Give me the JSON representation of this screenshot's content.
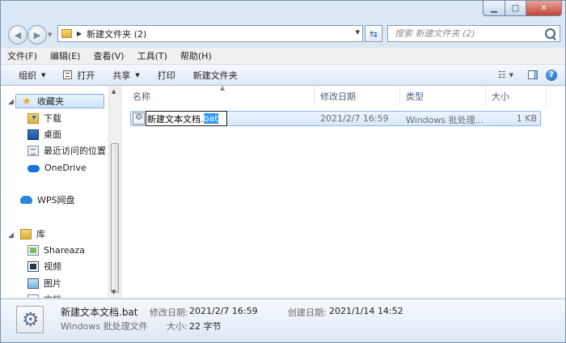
{
  "address": {
    "crumb": "新建文件夹 (2)",
    "search_placeholder": "搜索 新建文件夹 (2)"
  },
  "menubar": [
    "文件(F)",
    "编辑(E)",
    "查看(V)",
    "工具(T)",
    "帮助(H)"
  ],
  "toolbar": {
    "organize": "组织",
    "open": "打开",
    "share": "共享",
    "print": "打印",
    "new_folder": "新建文件夹"
  },
  "nav": {
    "favorites": "收藏夹",
    "downloads": "下载",
    "desktop": "桌面",
    "recent": "最近访问的位置",
    "onedrive": "OneDrive",
    "wps": "WPS网盘",
    "libraries": "库",
    "shareaza": "Shareaza",
    "videos": "视频",
    "pictures": "图片",
    "documents": "文档"
  },
  "columns": {
    "name": "名称",
    "modified": "修改日期",
    "type": "类型",
    "size": "大小"
  },
  "file": {
    "rename_base": "新建文本文档.",
    "rename_ext": "bat",
    "modified": "2021/2/7 16:59",
    "type": "Windows 批处理...",
    "size": "1 KB"
  },
  "details": {
    "name": "新建文本文档.bat",
    "type": "Windows 批处理文件",
    "modified_label": "修改日期:",
    "modified_value": "2021/2/7 16:59",
    "created_label": "创建日期:",
    "created_value": "2021/1/14 14:52",
    "size_label": "大小:",
    "size_value": "22 字节"
  },
  "icons": {
    "minimize": "minimize-icon",
    "maximize": "maximize-icon",
    "close": "close-icon",
    "back": "back-arrow-icon",
    "forward": "forward-arrow-icon",
    "folder": "folder-icon",
    "refresh": "refresh-icon",
    "search": "search-icon",
    "help": "help-icon"
  }
}
